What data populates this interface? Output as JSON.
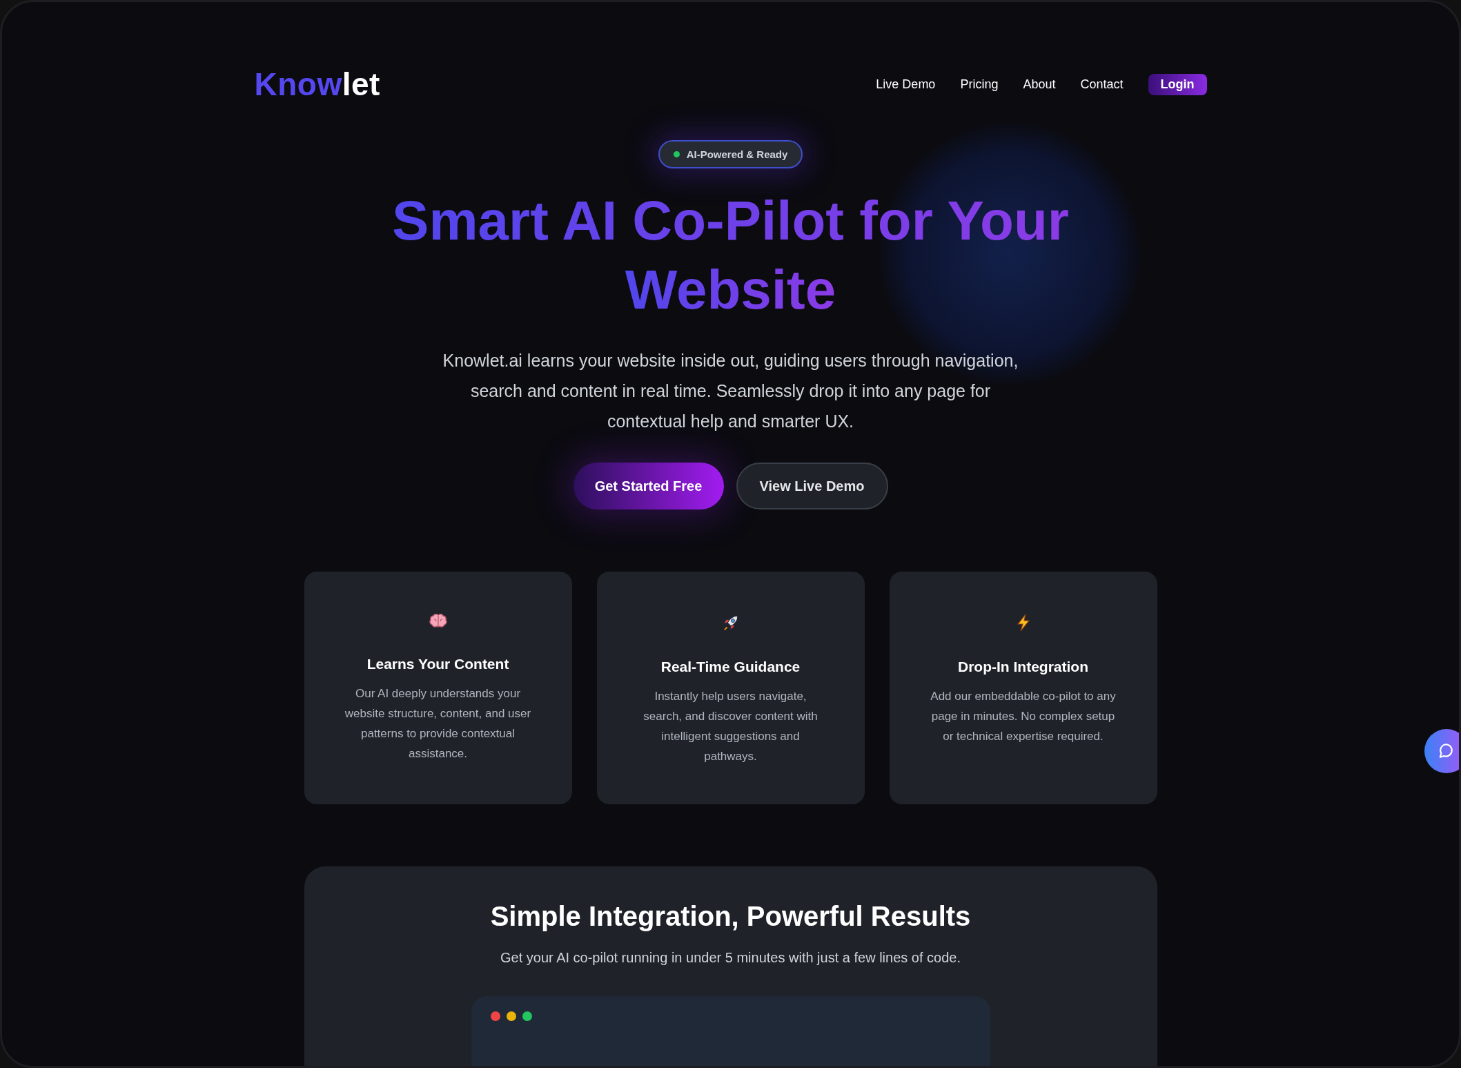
{
  "logo": {
    "primary": "Know",
    "secondary": "let"
  },
  "nav": [
    {
      "label": "Live Demo",
      "kind": "link"
    },
    {
      "label": "Pricing",
      "kind": "link"
    },
    {
      "label": "About",
      "kind": "link"
    },
    {
      "label": "Contact",
      "kind": "link"
    },
    {
      "label": "Login",
      "kind": "button"
    }
  ],
  "hero": {
    "badge": "AI-Powered & Ready",
    "title_lines": [
      "Smart AI Co-Pilot for Your",
      "Website"
    ],
    "description": "Knowlet.ai learns your website inside out, guiding users through navigation, search and content in real time. Seamlessly drop it into any page for contextual help and smarter UX.",
    "buttons": [
      {
        "label": "Get Started Free",
        "kind": "primary"
      },
      {
        "label": "View Live Demo",
        "kind": "secondary"
      }
    ]
  },
  "features": [
    {
      "kind": "brain",
      "title": "Learns Your Content",
      "text": "Our AI deeply understands your website structure, content, and user patterns to provide contextual assistance."
    },
    {
      "kind": "rocket",
      "title": "Real-Time Guidance",
      "text": "Instantly help users navigate, search, and discover content with intelligent suggestions and pathways."
    },
    {
      "kind": "bolt",
      "title": "Drop-In Integration",
      "text": "Add our embeddable co-pilot to any page in minutes. No complex setup or technical expertise required."
    }
  ],
  "integration": {
    "title": "Simple Integration, Powerful Results",
    "subtitle": "Get your AI co-pilot running in under 5 minutes with just a few lines of code.",
    "window_dots": [
      {
        "color": "#ef4444"
      },
      {
        "color": "#eab308"
      },
      {
        "color": "#22c55e"
      }
    ]
  }
}
